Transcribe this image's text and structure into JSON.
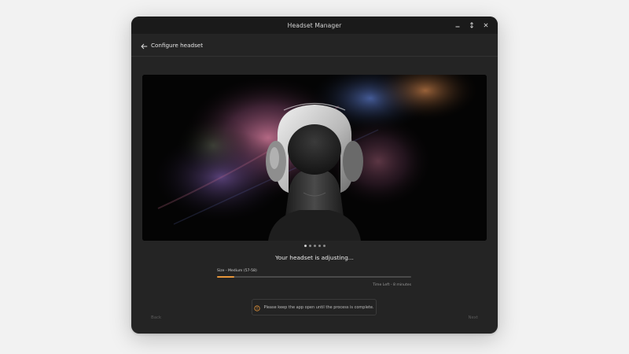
{
  "window": {
    "title": "Headset Manager"
  },
  "window_controls": {
    "minimize_icon": "minimize-icon",
    "maximize_icon": "maximize-icon",
    "close_icon": "close-icon"
  },
  "header": {
    "back_icon": "arrow-left-icon",
    "title": "Configure headset"
  },
  "carousel": {
    "dot_count": 5,
    "active_index": 0
  },
  "status": {
    "message": "Your headset is adjusting..."
  },
  "size": {
    "label": "Size - Medium (57-58)"
  },
  "progress": {
    "fraction": 0.09,
    "color": "#e8963a",
    "time_left": "Time Left - 8 minutes"
  },
  "notice": {
    "icon": "info-circle-icon",
    "text": "Please keep the app open until the process is complete."
  },
  "footer": {
    "back_label": "Back",
    "next_label": "Next"
  },
  "colors": {
    "accent": "#e8963a",
    "background": "#242424",
    "titlebar": "#1a1a1a"
  }
}
